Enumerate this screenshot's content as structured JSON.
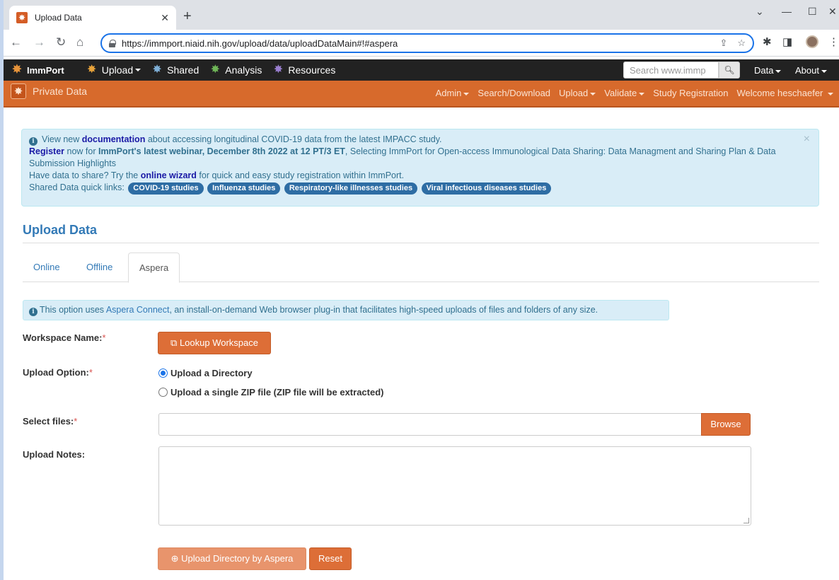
{
  "browser": {
    "tab_title": "Upload Data",
    "url": "https://immport.niaid.nih.gov/upload/data/uploadDataMain#!#aspera"
  },
  "topnav": {
    "brand": "ImmPort",
    "items": [
      "Upload",
      "Shared",
      "Analysis",
      "Resources"
    ],
    "search_placeholder": "Search www.immp",
    "data_menu": "Data",
    "about_menu": "About"
  },
  "privnav": {
    "brand": "Private Data",
    "links": [
      "Admin",
      "Search/Download",
      "Upload",
      "Validate",
      "Study Registration",
      "Welcome heschaefer"
    ]
  },
  "alert": {
    "line1_pre": "View new ",
    "line1_link": "documentation",
    "line1_post": " about accessing longitudinal COVID-19 data from the latest IMPACC study.",
    "line2_link": "Register",
    "line2_mid": " now for ",
    "line2_bold": "ImmPort's latest webinar, December 8th 2022 at 12 PT/3 ET",
    "line2_post": ", Selecting ImmPort for Open-access Immunological Data Sharing: Data Managment and Sharing Plan & Data Submission Highlights",
    "line3_pre": "Have data to share? Try the ",
    "line3_link": "online wizard",
    "line3_post": " for quick and easy study registration within ImmPort.",
    "quicklinks_label": "Shared Data quick links:",
    "quicklinks": [
      "COVID-19 studies",
      "Influenza studies",
      "Respiratory-like illnesses studies",
      "Viral infectious diseases studies"
    ]
  },
  "page": {
    "title": "Upload Data",
    "tabs": [
      "Online",
      "Offline",
      "Aspera"
    ],
    "info_pre": "This option uses ",
    "info_link": "Aspera Connect",
    "info_post": ", an install-on-demand Web browser plug-in that facilitates high-speed uploads of files and folders of any size."
  },
  "form": {
    "workspace_label": "Workspace Name:",
    "lookup_button": "Lookup Workspace",
    "upload_option_label": "Upload Option:",
    "option_directory": "Upload a Directory",
    "option_zip": "Upload a single ZIP file (ZIP file will be extracted)",
    "select_files_label": "Select files:",
    "browse_button": "Browse",
    "notes_label": "Upload Notes:",
    "upload_button": "Upload Directory by Aspera",
    "reset_button": "Reset",
    "required_mark": "*"
  },
  "icons": {
    "lookup": "external-link-icon",
    "upload": "arrow-circle-up-icon",
    "info": "info-circle-icon"
  },
  "colors": {
    "brand_orange": "#dd6e37",
    "nav_dark": "#222222",
    "link_blue": "#337ab7",
    "info_bg": "#d9edf7"
  }
}
